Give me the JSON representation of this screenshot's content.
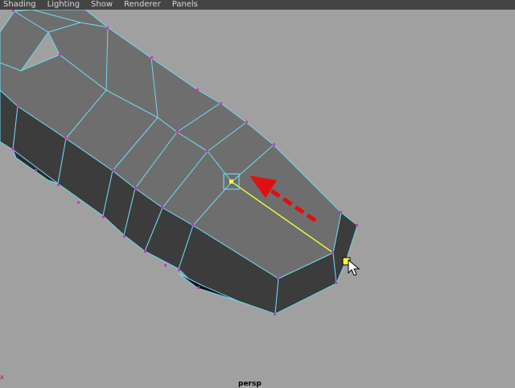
{
  "menubar": {
    "items": [
      "Shading",
      "Lighting",
      "Show",
      "Renderer",
      "Panels"
    ]
  },
  "viewport": {
    "camera_label": "persp",
    "axis_label": "x"
  },
  "colors": {
    "menubar_bg": "#444444",
    "viewport_bg": "#a0a0a0",
    "face_top": "#6e6e6e",
    "face_side": "#3c3c3c",
    "edge": "#6fd6f0",
    "vertex": "#cc33cc",
    "selected_edge": "#ffff33",
    "annotation_arrow": "#e01010",
    "camera_label": "#000000",
    "axis_x": "#d01010"
  },
  "icons": {
    "cursor": "arrow-cursor-icon",
    "annotation": "red-dashed-arrow-icon",
    "vertex_marker": "selected-vertex-marker-icon"
  }
}
